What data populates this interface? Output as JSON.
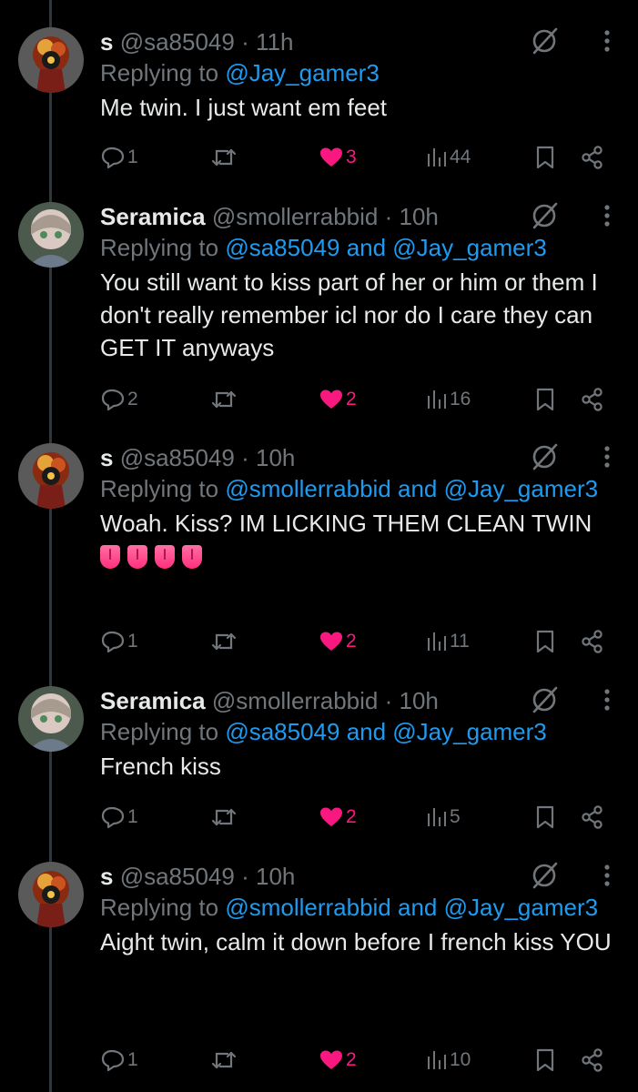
{
  "tweets": [
    {
      "avatar": "avatar-s",
      "name": "s",
      "handle": "@sa85049",
      "time": "11h",
      "replying_prefix": "Replying to",
      "replying_to": "@Jay_gamer3",
      "text": "Me twin. I just want em feet",
      "emoji": [],
      "replies": "1",
      "reposts": "",
      "likes": "3",
      "views": "44"
    },
    {
      "avatar": "avatar-seramica",
      "name": "Seramica",
      "handle": "@smollerrabbid",
      "time": "10h",
      "replying_prefix": "Replying to",
      "replying_to": "@sa85049 and @Jay_gamer3",
      "text": "You still want to kiss part of her or him or them I don't really remember icl nor do I care they can GET IT anyways",
      "emoji": [],
      "replies": "2",
      "reposts": "",
      "likes": "2",
      "views": "16"
    },
    {
      "avatar": "avatar-s",
      "name": "s",
      "handle": "@sa85049",
      "time": "10h",
      "replying_prefix": "Replying to",
      "replying_to": "@smollerrabbid and @Jay_gamer3",
      "text": "Woah. Kiss? IM LICKING THEM CLEAN TWIN",
      "emoji": [
        "tongue",
        "tongue",
        "tongue",
        "tongue"
      ],
      "replies": "1",
      "reposts": "",
      "likes": "2",
      "views": "11"
    },
    {
      "avatar": "avatar-seramica",
      "name": "Seramica",
      "handle": "@smollerrabbid",
      "time": "10h",
      "replying_prefix": "Replying to",
      "replying_to": "@sa85049 and @Jay_gamer3",
      "text": "French kiss",
      "emoji": [],
      "replies": "1",
      "reposts": "",
      "likes": "2",
      "views": "5"
    },
    {
      "avatar": "avatar-s",
      "name": "s",
      "handle": "@sa85049",
      "time": "10h",
      "replying_prefix": "Replying to",
      "replying_to": "@smollerrabbid and @Jay_gamer3",
      "text": "Aight twin, calm it down before I french kiss YOU",
      "emoji": [],
      "replies": "1",
      "reposts": "",
      "likes": "2",
      "views": "10"
    }
  ],
  "separator": "·",
  "colors": {
    "background": "#000000",
    "text": "#e7e9ea",
    "muted": "#71767b",
    "link": "#1d9bf0",
    "like": "#f91880"
  }
}
